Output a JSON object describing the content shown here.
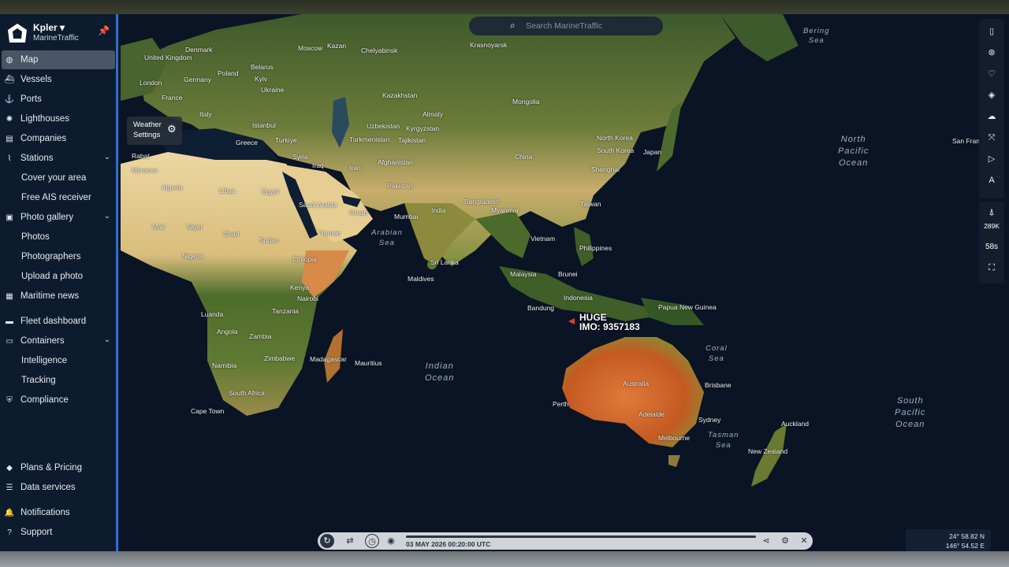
{
  "sidebar": {
    "brand": "Kpler ▾",
    "brand_sub": "MarineTraffic",
    "items": [
      {
        "label": "Map",
        "icon": "globe-icon"
      },
      {
        "label": "Vessels",
        "icon": "ship-icon"
      },
      {
        "label": "Ports",
        "icon": "anchor-icon"
      },
      {
        "label": "Lighthouses",
        "icon": "lighthouse-icon"
      },
      {
        "label": "Companies",
        "icon": "company-icon"
      },
      {
        "label": "Stations",
        "icon": "antenna-icon"
      },
      {
        "label": "Cover your area"
      },
      {
        "label": "Free AIS receiver"
      },
      {
        "label": "Photo gallery",
        "icon": "photo-icon"
      },
      {
        "label": "Photos"
      },
      {
        "label": "Photographers"
      },
      {
        "label": "Upload a photo"
      },
      {
        "label": "Maritime news",
        "icon": "news-icon"
      },
      {
        "label": "Fleet dashboard",
        "icon": "fleet-icon"
      },
      {
        "label": "Containers",
        "icon": "container-icon"
      },
      {
        "label": "Intelligence"
      },
      {
        "label": "Tracking"
      },
      {
        "label": "Compliance",
        "icon": "shield-icon"
      },
      {
        "label": "Plans & Pricing",
        "icon": "tag-icon"
      },
      {
        "label": "Data services",
        "icon": "database-icon"
      },
      {
        "label": "Notifications",
        "icon": "bell-icon"
      },
      {
        "label": "Support",
        "icon": "help-icon"
      }
    ]
  },
  "search": {
    "placeholder": "Search MarineTraffic"
  },
  "weather": {
    "line1": "Weather",
    "line2": "Settings"
  },
  "map": {
    "places": [
      "Denmark",
      "Moscow",
      "Kazan",
      "Chelyabinsk",
      "Krasnoyarsk",
      "United Kingdom",
      "London",
      "Germany",
      "Poland",
      "Belarus",
      "Kyiv",
      "Ukraine",
      "France",
      "Italy",
      "Istanbul",
      "Greece",
      "Turkiye",
      "Kazakhstan",
      "Mongolia",
      "Uzbekistan",
      "Kyrgyzstan",
      "Almaty",
      "Turkmenistan",
      "Tajikistan",
      "Iran",
      "Iraq",
      "Syria",
      "Afghanistan",
      "Pakistan",
      "China",
      "North Korea",
      "South Korea",
      "Japan",
      "Shanghai",
      "Taiwan",
      "Morocco",
      "Rabat",
      "Algeria",
      "Libya",
      "Egypt",
      "Saudi Arabia",
      "Yemen",
      "Oman",
      "Mumbai",
      "India",
      "Bangladesh",
      "Myanmar",
      "Vietnam",
      "Philippines",
      "Sri Lanka",
      "Malaysia",
      "Brunei",
      "Maldives",
      "Indonesia",
      "Bandung",
      "Papua New Guinea",
      "Mali",
      "Niger",
      "Chad",
      "Sudan",
      "Nigeria",
      "Ethiopia",
      "Kenya",
      "Nairobi",
      "Tanzania",
      "Luanda",
      "Angola",
      "Zambia",
      "Zimbabwe",
      "Namibia",
      "Madagascar",
      "Mauritius",
      "South Africa",
      "Cape Town",
      "Australia",
      "Perth",
      "Adelaide",
      "Melbourne",
      "Brisbane",
      "Sydney",
      "Auckland",
      "New Zealand",
      "San Fran"
    ],
    "seas": {
      "bering": "Bering\nSea",
      "north_pacific": "North\nPacific\nOcean",
      "arabian": "Arabian\nSea",
      "indian": "Indian\nOcean",
      "coral": "Coral\nSea",
      "tasman": "Tasman\nSea",
      "south_pacific": "South\nPacific\nOcean"
    }
  },
  "vessel": {
    "name": "HUGE",
    "imo": "IMO: 9357183"
  },
  "controls": {
    "count": "289K",
    "seconds": "58s"
  },
  "timeline": {
    "timestamp": "03 MAY 2026 00:20:00 UTC"
  },
  "coords": {
    "lat": "24° 58.82 N",
    "lon": "146° 54.52 E"
  },
  "colors": {
    "sidebar_bg": "#0d1b2e",
    "accent": "#2e6fd1",
    "vessel": "#e53c2c"
  }
}
